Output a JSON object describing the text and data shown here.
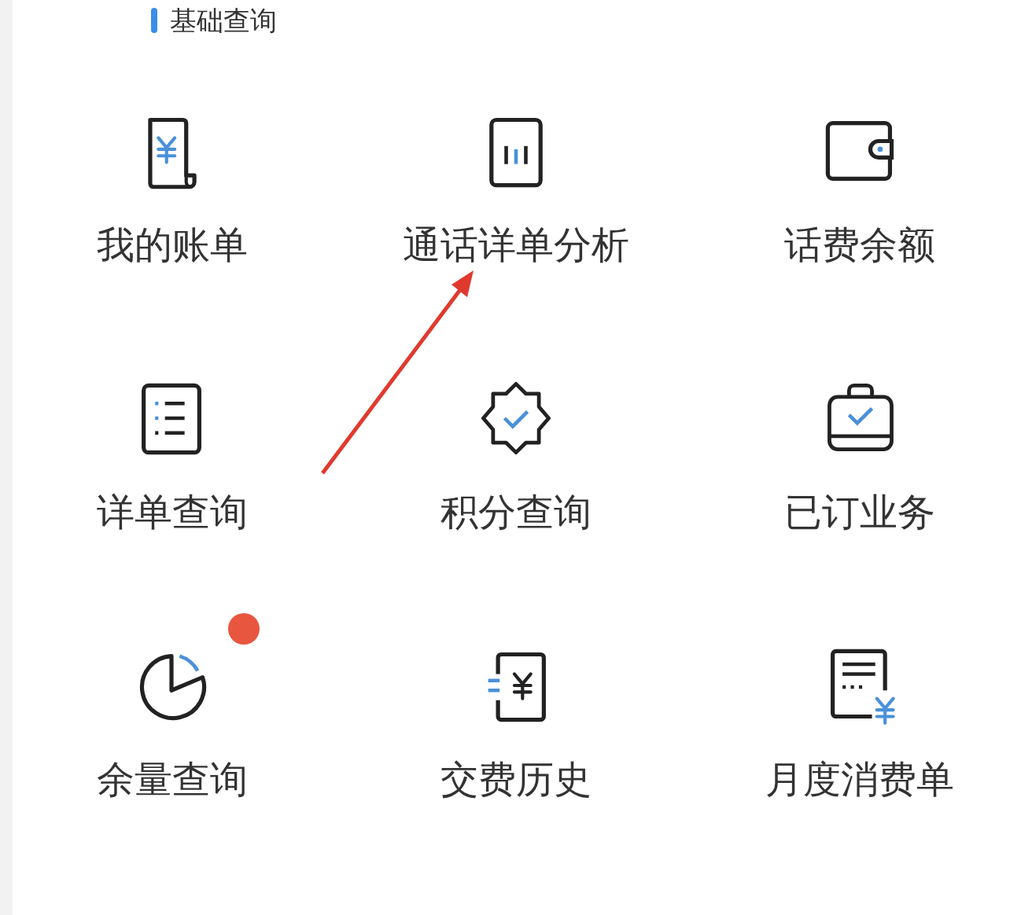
{
  "section": {
    "title": "基础查询"
  },
  "items": [
    {
      "kind": "bill",
      "label": "我的账单",
      "badge": false
    },
    {
      "kind": "chart-card",
      "label": "通话详单分析",
      "badge": false
    },
    {
      "kind": "wallet",
      "label": "话费余额",
      "badge": false
    },
    {
      "kind": "list",
      "label": "详单查询",
      "badge": false
    },
    {
      "kind": "star-badge",
      "label": "积分查询",
      "badge": false
    },
    {
      "kind": "bag",
      "label": "已订业务",
      "badge": false
    },
    {
      "kind": "pie",
      "label": "余量查询",
      "badge": true
    },
    {
      "kind": "payment",
      "label": "交费历史",
      "badge": false
    },
    {
      "kind": "statement",
      "label": "月度消费单",
      "badge": false
    }
  ],
  "annotation": {
    "arrow": true
  }
}
